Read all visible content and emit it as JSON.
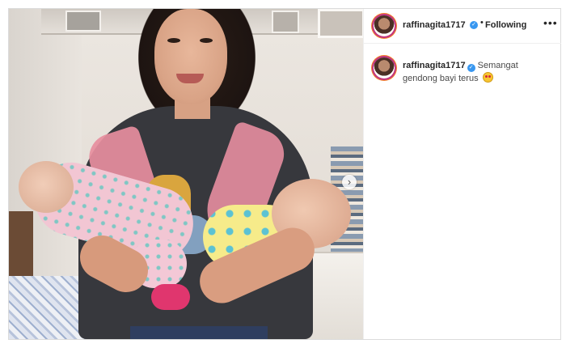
{
  "post": {
    "username": "raffinagita1717",
    "follow_status": "Following",
    "separator": "•",
    "more_icon": "more-horizontal-icon",
    "verified_icon": "verified-badge-icon"
  },
  "caption": {
    "username": "raffinagita1717",
    "text": "Semangat gendong bayi terus",
    "emoji": "heart-eyes-emoji"
  },
  "media": {
    "next_icon": "chevron-right-icon",
    "next_glyph": "›"
  },
  "colors": {
    "verified": "#3897f0",
    "border": "#dbdbdb",
    "text": "#262626"
  }
}
